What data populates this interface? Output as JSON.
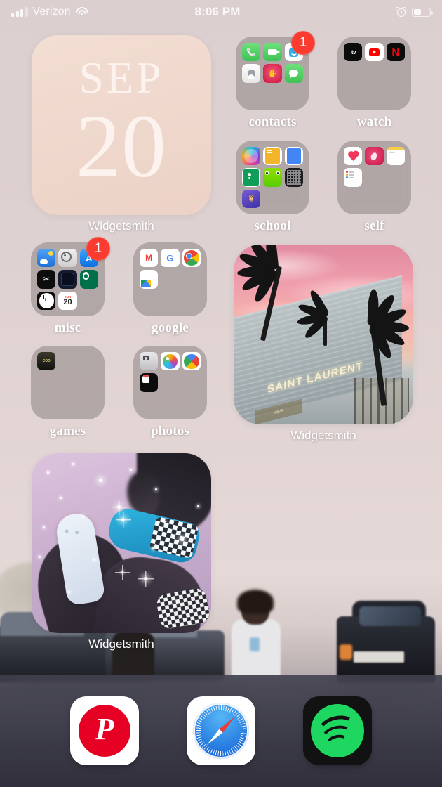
{
  "statusbar": {
    "carrier": "Verizon",
    "time": "8:06 PM",
    "signal_icon": "signal-bars-icon",
    "wifi_icon": "wifi-icon",
    "alarm_icon": "alarm-clock-icon",
    "battery_icon": "battery-icon",
    "battery_percent": 45
  },
  "widgets": {
    "date": {
      "month": "SEP",
      "day": "20",
      "label": "Widgetsmith",
      "bg_color": "#efd8cd",
      "text_color": "#fdf3ee"
    },
    "sunset_photo": {
      "label": "Widgetsmith",
      "sign_text": "SAINT LAURENT",
      "address_text": "469"
    },
    "shoes_photo": {
      "label": "Widgetsmith"
    }
  },
  "folders": [
    {
      "name": "contacts",
      "badge": "1",
      "apps": [
        {
          "name": "Phone",
          "icon": "phone-icon"
        },
        {
          "name": "FaceTime",
          "icon": "facetime-icon"
        },
        {
          "name": "Bitmoji",
          "icon": "bitmoji-icon"
        },
        {
          "name": "Contacts",
          "icon": "contacts-icon"
        },
        {
          "name": "Life360",
          "icon": "hand-icon"
        },
        {
          "name": "Messages",
          "icon": "messages-icon"
        }
      ]
    },
    {
      "name": "watch",
      "badge": "",
      "apps": [
        {
          "name": "Apple TV",
          "icon": "appletv-icon",
          "text": " tv"
        },
        {
          "name": "YouTube",
          "icon": "youtube-icon"
        },
        {
          "name": "Netflix",
          "icon": "netflix-icon",
          "text": "N"
        }
      ]
    },
    {
      "name": "school",
      "badge": "",
      "apps": [
        {
          "name": "Canva",
          "icon": "canva-icon"
        },
        {
          "name": "Pages",
          "icon": "pages-icon"
        },
        {
          "name": "Google Docs",
          "icon": "google-docs-icon"
        },
        {
          "name": "Google Classroom",
          "icon": "classroom-icon"
        },
        {
          "name": "Duolingo",
          "icon": "duolingo-icon"
        },
        {
          "name": "Calculator",
          "icon": "calculator-icon"
        },
        {
          "name": "Study App",
          "icon": "owl-purple-icon"
        }
      ]
    },
    {
      "name": "self",
      "badge": "",
      "apps": [
        {
          "name": "Health",
          "icon": "health-icon"
        },
        {
          "name": "Period Tracker",
          "icon": "pink-leaf-icon"
        },
        {
          "name": "Notes",
          "icon": "notes-icon"
        },
        {
          "name": "Reminders",
          "icon": "reminders-icon"
        }
      ]
    },
    {
      "name": "misc",
      "badge": "1",
      "apps": [
        {
          "name": "Weather",
          "icon": "weather-icon"
        },
        {
          "name": "Settings",
          "icon": "settings-gear-icon"
        },
        {
          "name": "App Store",
          "icon": "app-store-icon",
          "text": "A"
        },
        {
          "name": "Jaybird",
          "icon": "dark-wings-icon",
          "text": "✂"
        },
        {
          "name": "Wallet",
          "icon": "dark-navy-icon"
        },
        {
          "name": "Starbucks",
          "icon": "starbucks-icon"
        },
        {
          "name": "Clock",
          "icon": "clock-icon"
        },
        {
          "name": "Calendar",
          "icon": "calendar-icon",
          "weekday": "SUN",
          "day": "20"
        }
      ]
    },
    {
      "name": "google",
      "badge": "",
      "apps": [
        {
          "name": "Gmail",
          "icon": "gmail-icon",
          "text": "M"
        },
        {
          "name": "Google",
          "icon": "google-icon",
          "text": "G"
        },
        {
          "name": "Chrome",
          "icon": "chrome-icon"
        },
        {
          "name": "Google Drive",
          "icon": "google-drive-icon"
        }
      ]
    },
    {
      "name": "games",
      "badge": "",
      "apps": [
        {
          "name": "Call of Duty",
          "icon": "call-of-duty-icon",
          "text": "COD"
        }
      ]
    },
    {
      "name": "photos",
      "badge": "",
      "apps": [
        {
          "name": "Camera",
          "icon": "camera-icon"
        },
        {
          "name": "Photos",
          "icon": "photos-icon"
        },
        {
          "name": "Google Photos",
          "icon": "google-photos-icon"
        },
        {
          "name": "VSCO",
          "icon": "vsco-icon"
        }
      ]
    }
  ],
  "dock": [
    {
      "name": "Pinterest",
      "icon": "pinterest-icon",
      "glyph": "P",
      "color": "#e60023"
    },
    {
      "name": "Safari",
      "icon": "safari-compass-icon",
      "color": "#1565d8"
    },
    {
      "name": "Spotify",
      "icon": "spotify-icon",
      "color": "#1ed760"
    }
  ]
}
